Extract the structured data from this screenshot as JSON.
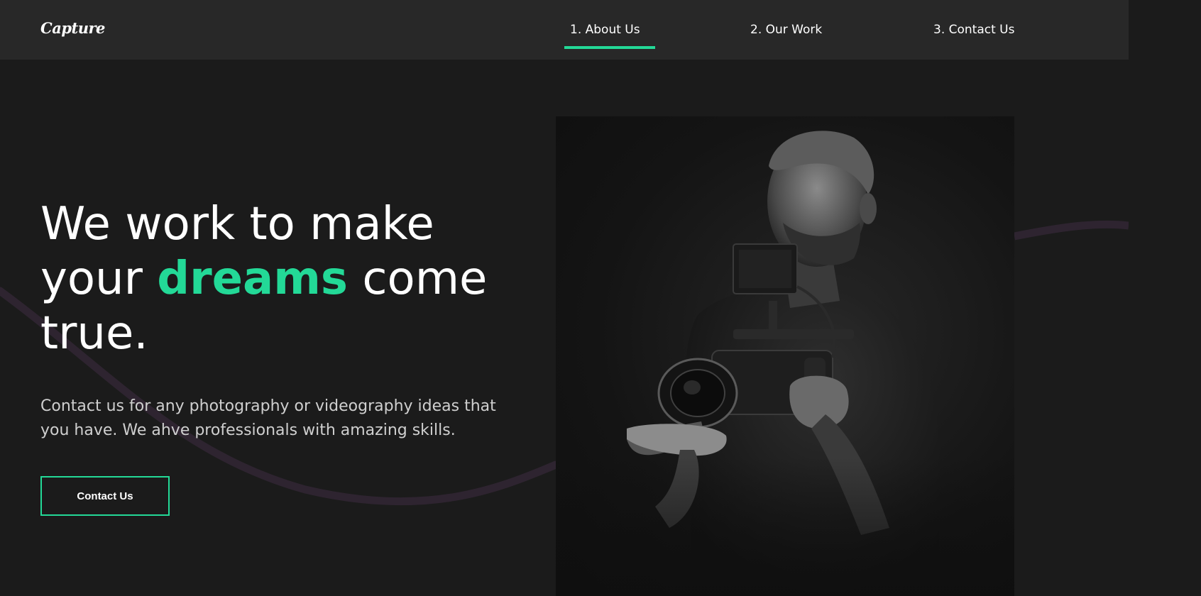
{
  "nav": {
    "logo": "Capture",
    "links": [
      {
        "label": "1. About Us",
        "active": true
      },
      {
        "label": "2. Our Work",
        "active": false
      },
      {
        "label": "3. Contact Us",
        "active": false
      }
    ]
  },
  "hero": {
    "title_line1": "We work to make",
    "title_line2_pre": "your ",
    "title_line2_accent": "dreams",
    "title_line2_post": " come",
    "title_line3": "true.",
    "description_line1": "Contact us for any photography or videography ideas that",
    "description_line2": "you have. We ahve professionals with amazing skills.",
    "cta_label": "Contact Us"
  },
  "colors": {
    "accent": "#23d997",
    "background": "#1b1b1b",
    "nav_background": "#282828",
    "wave": "#2e2430"
  },
  "image": {
    "subject": "videographer-with-camera-rig"
  }
}
